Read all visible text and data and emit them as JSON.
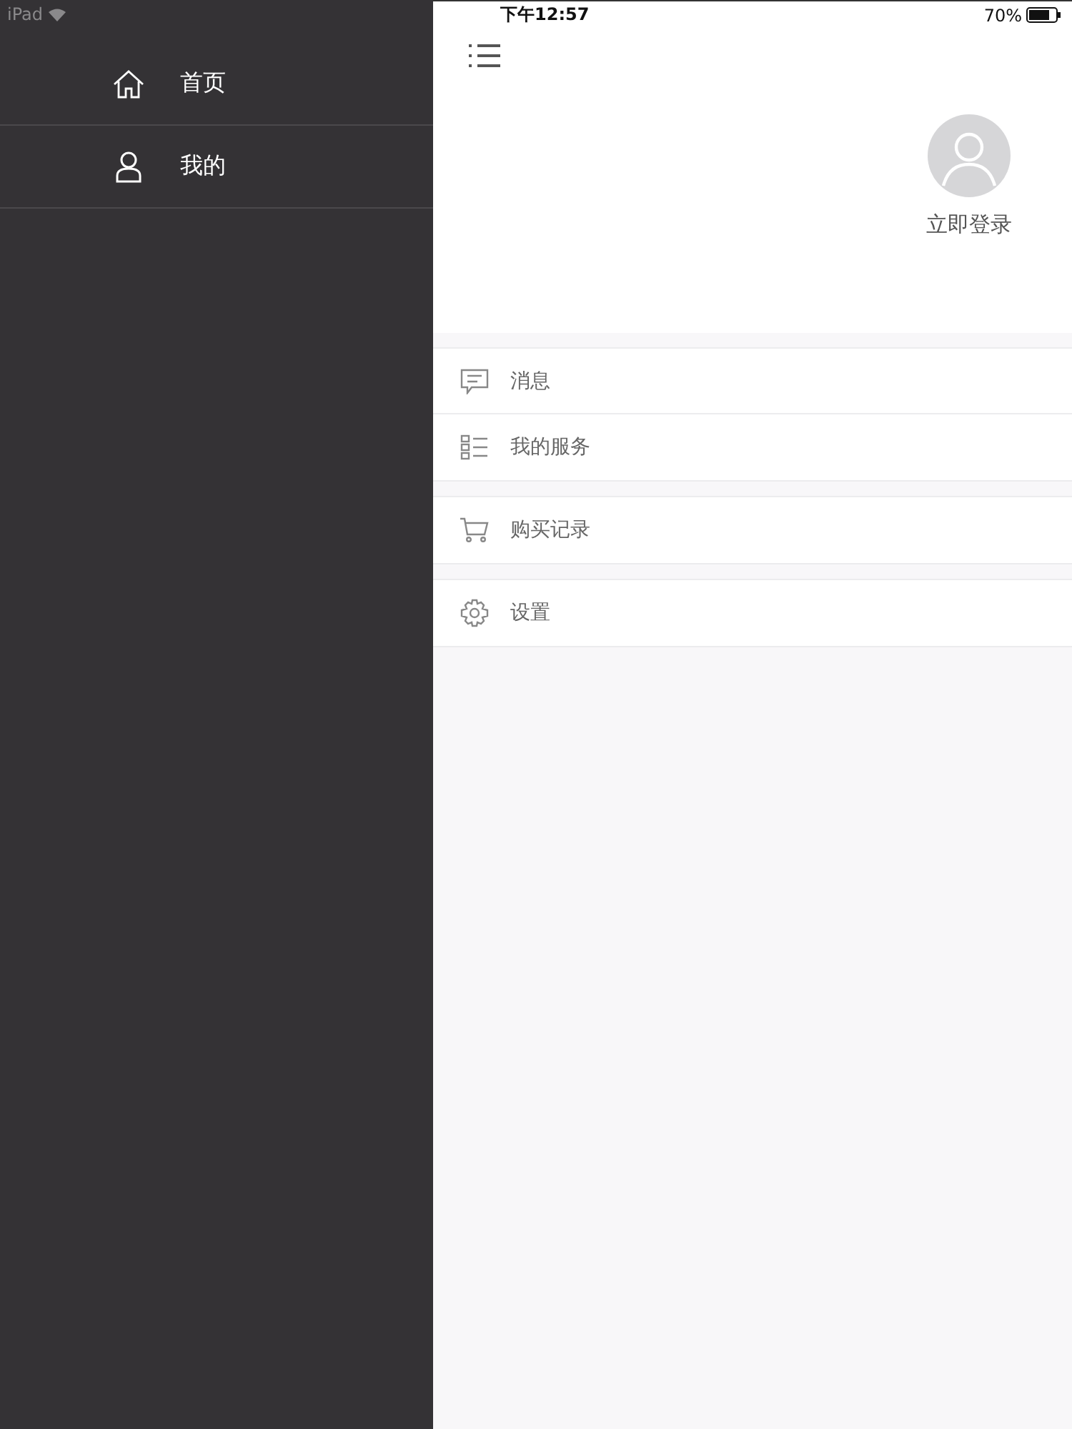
{
  "status_bar": {
    "device": "iPad",
    "time": "下午12:57",
    "battery": "70%"
  },
  "sidebar": {
    "items": [
      {
        "label": "首页"
      },
      {
        "label": "我的"
      }
    ]
  },
  "profile": {
    "login": "立即登录"
  },
  "menu_groups": [
    [
      {
        "label": "消息"
      },
      {
        "label": "我的服务"
      }
    ],
    [
      {
        "label": "购买记录"
      }
    ],
    [
      {
        "label": "设置"
      }
    ]
  ]
}
